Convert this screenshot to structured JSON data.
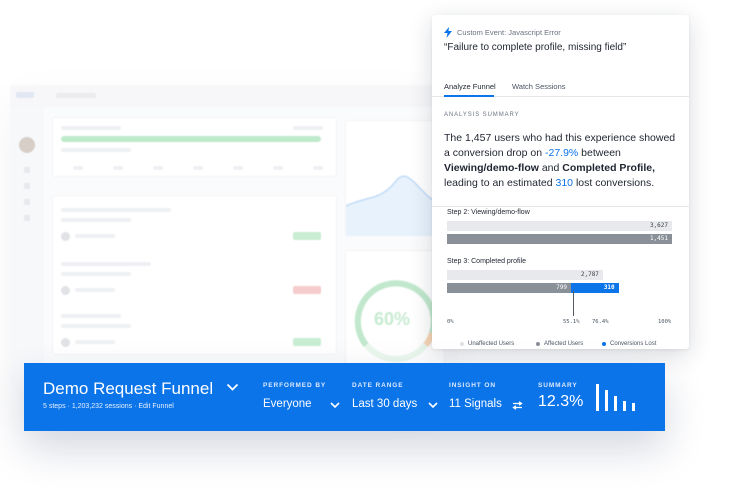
{
  "panel": {
    "event_label": "Custom Event: Javascript Error",
    "event_title": "“Failure to complete profile, missing field”",
    "tabs": [
      "Analyze Funnel",
      "Watch Sessions"
    ],
    "active_tab": "Analyze Funnel",
    "summary_heading": "ANALYSIS SUMMARY",
    "summary": {
      "p1": "The 1,457 users who had this experience showed a conversion drop on ",
      "drop": "-27.9%",
      "p2": " between ",
      "step_a": "Viewing/demo-flow",
      "p3": " and ",
      "step_b": "Completed Profile,",
      "p4": " leading to an estimated ",
      "lost": "310",
      "p5": " lost conversions."
    },
    "steps": [
      {
        "label": "Step 2: Viewing/demo-flow",
        "unaffected": "3,627",
        "affected": "1,451",
        "unaffected_fraction": 1.0,
        "affected_fraction": 1.0
      },
      {
        "label": "Step 3: Completed profile",
        "unaffected": "2,787",
        "affected": "799",
        "lost": "310",
        "unaffected_fraction": 0.693,
        "affected_fraction": 0.551,
        "lost_fraction": 0.212
      }
    ],
    "ticks": [
      "0%",
      "55.1%",
      "76.4%",
      "100%"
    ],
    "legend": [
      {
        "label": "Unaffected Users",
        "color": "#e0e2e6"
      },
      {
        "label": "Affected Users",
        "color": "#8a9097"
      },
      {
        "label": "Conversions Lost",
        "color": "#0b74e9"
      }
    ]
  },
  "funnel": {
    "title": "Demo Request Funnel",
    "steps": "5 steps",
    "sessions": "1,203,232 sessions",
    "edit_link": "Edit Funnel",
    "performed_by_label": "PERFORMED BY",
    "performed_by_value": "Everyone",
    "date_range_label": "DATE RANGE",
    "date_range_value": "Last 30 days",
    "insight_label": "INSIGHT ON",
    "insight_value": "11 Signals",
    "summary_label": "SUMMARY",
    "summary_value": "12.3%",
    "mini_bar_levels": [
      1.0,
      0.78,
      0.55,
      0.38,
      0.28
    ],
    "accent": "#0b74e9"
  },
  "background": {
    "gauge_value": "60%"
  }
}
